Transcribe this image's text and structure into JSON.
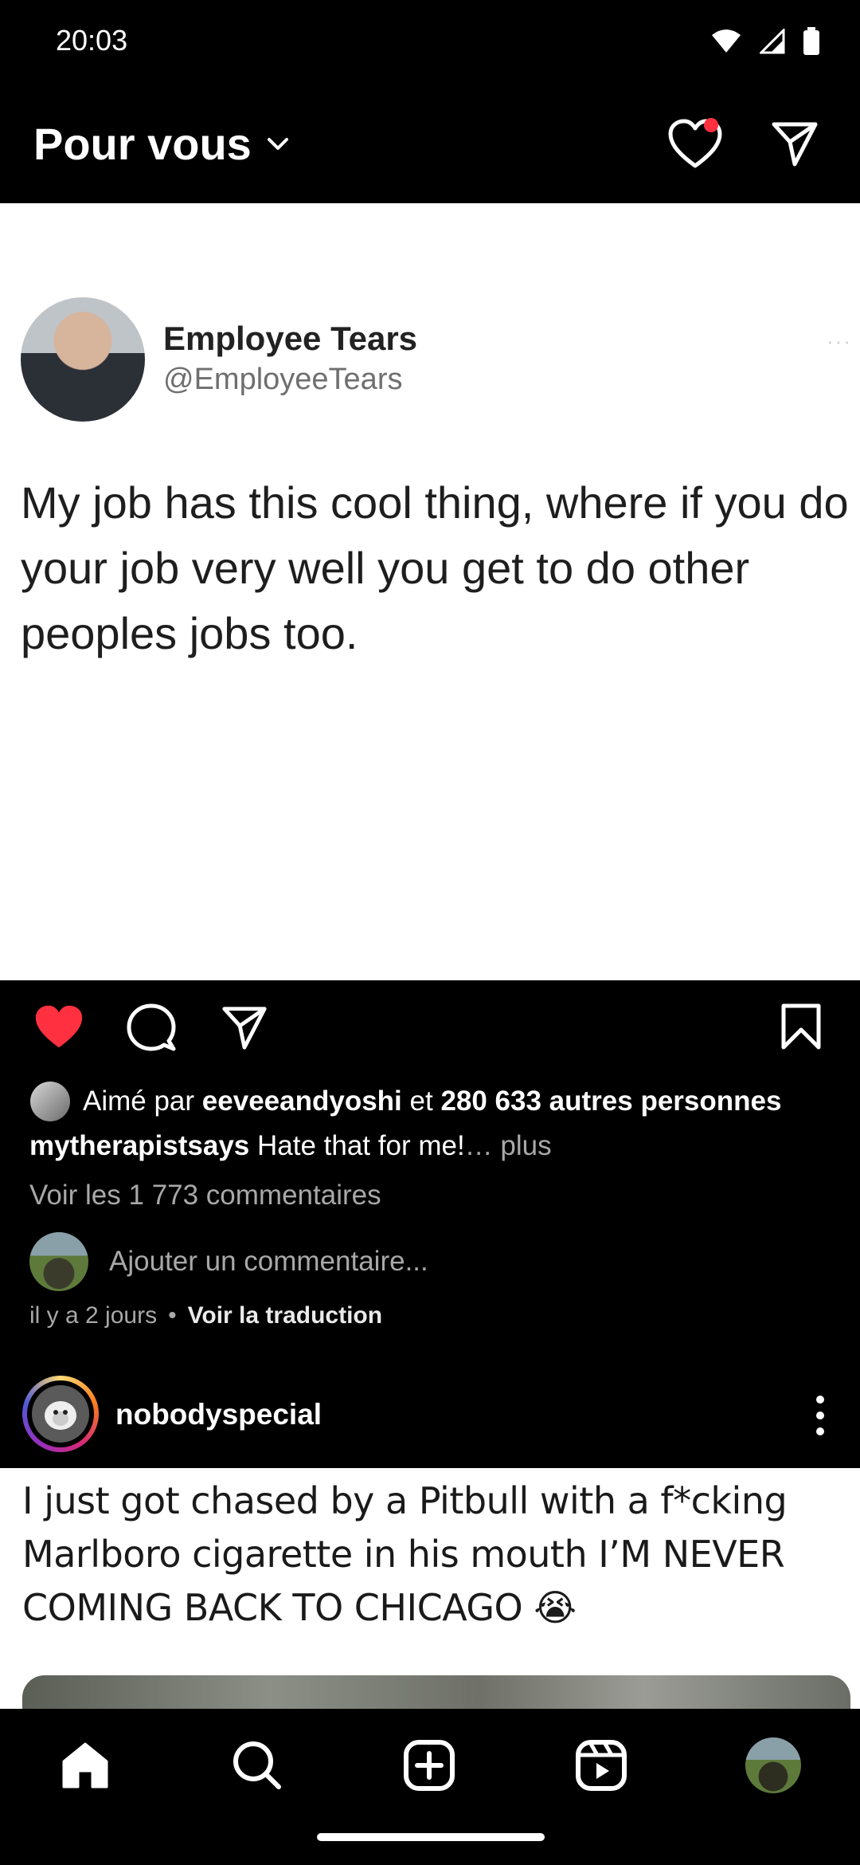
{
  "status_bar": {
    "time": "20:03"
  },
  "header": {
    "title": "Pour vous"
  },
  "post1": {
    "tweet": {
      "name": "Employee Tears",
      "handle": "@EmployeeTears",
      "text": "My job has this cool thing, where if you do your job very well you get to do other peoples jobs too."
    },
    "likes": {
      "prefix": "Aimé par",
      "user": "eeveeandyoshi",
      "joiner": "et",
      "others": "280 633 autres personnes"
    },
    "caption": {
      "user": "mytherapistsays",
      "text": "Hate that for me!",
      "more": "… plus"
    },
    "view_comments": "Voir les 1 773 commentaires",
    "add_comment_placeholder": "Ajouter un commentaire...",
    "time_ago": "il y a 2 jours",
    "separator": "•",
    "translate": "Voir la traduction"
  },
  "post2": {
    "username": "nobodyspecial",
    "text": "I just got chased by a Pitbull with a f*cking Marlboro cigarette in his mouth I’M NEVER COMING BACK TO CHICAGO 😭"
  },
  "colors": {
    "like_red": "#ff3040",
    "notification_dot": "#ff3040"
  },
  "icons": {
    "header": [
      "chevron-down-icon",
      "heart-icon",
      "send-icon"
    ],
    "actions": [
      "heart-filled-icon",
      "comment-icon",
      "share-icon",
      "bookmark-icon"
    ],
    "nav": [
      "home-icon",
      "search-icon",
      "add-post-icon",
      "reels-icon",
      "profile-avatar"
    ]
  }
}
